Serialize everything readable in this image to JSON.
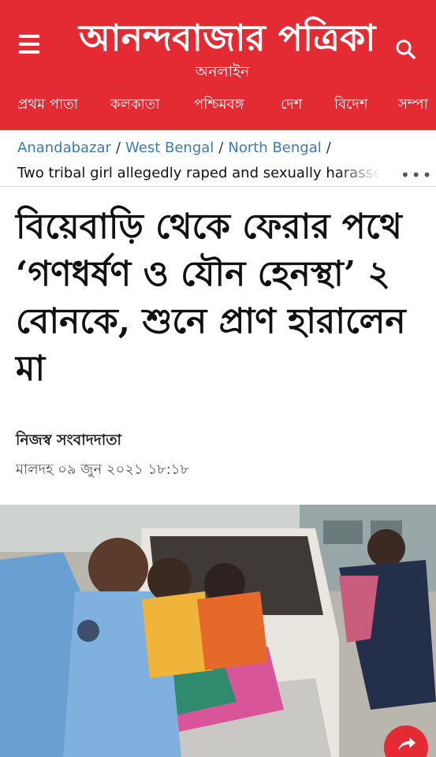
{
  "header": {
    "masthead": "আনন্দবাজার পত্রিকা",
    "sub_masthead": "অনলাইন",
    "nav": [
      "প্রথম পাতা",
      "কলকাতা",
      "পশ্চিমবঙ্গ",
      "দেশ",
      "বিদেশ",
      "সম্পা"
    ]
  },
  "breadcrumb": {
    "items": [
      "Anandabazar",
      "West Bengal",
      "North Bengal"
    ],
    "separator": "/",
    "current": "Two tribal girl allegedly raped and sexually harassed"
  },
  "article": {
    "headline": "বিয়েবাড়ি থেকে ফেরার পথে ‘গণধর্ষণ ও যৌন হেনস্থা’ ২ বোনকে, শুনে প্রাণ হারালেন মা",
    "byline": "নিজস্ব সংবাদদাতা",
    "dateline": "মালদহ ০৯ জুন ২০২১ ১৮:১৮"
  },
  "colors": {
    "brand_red": "#e42a32",
    "link_blue": "#3b7ab8"
  },
  "icons": {
    "menu": "hamburger-menu-icon",
    "search": "search-icon",
    "more": "more-dots-icon",
    "share": "share-arrow-icon"
  }
}
